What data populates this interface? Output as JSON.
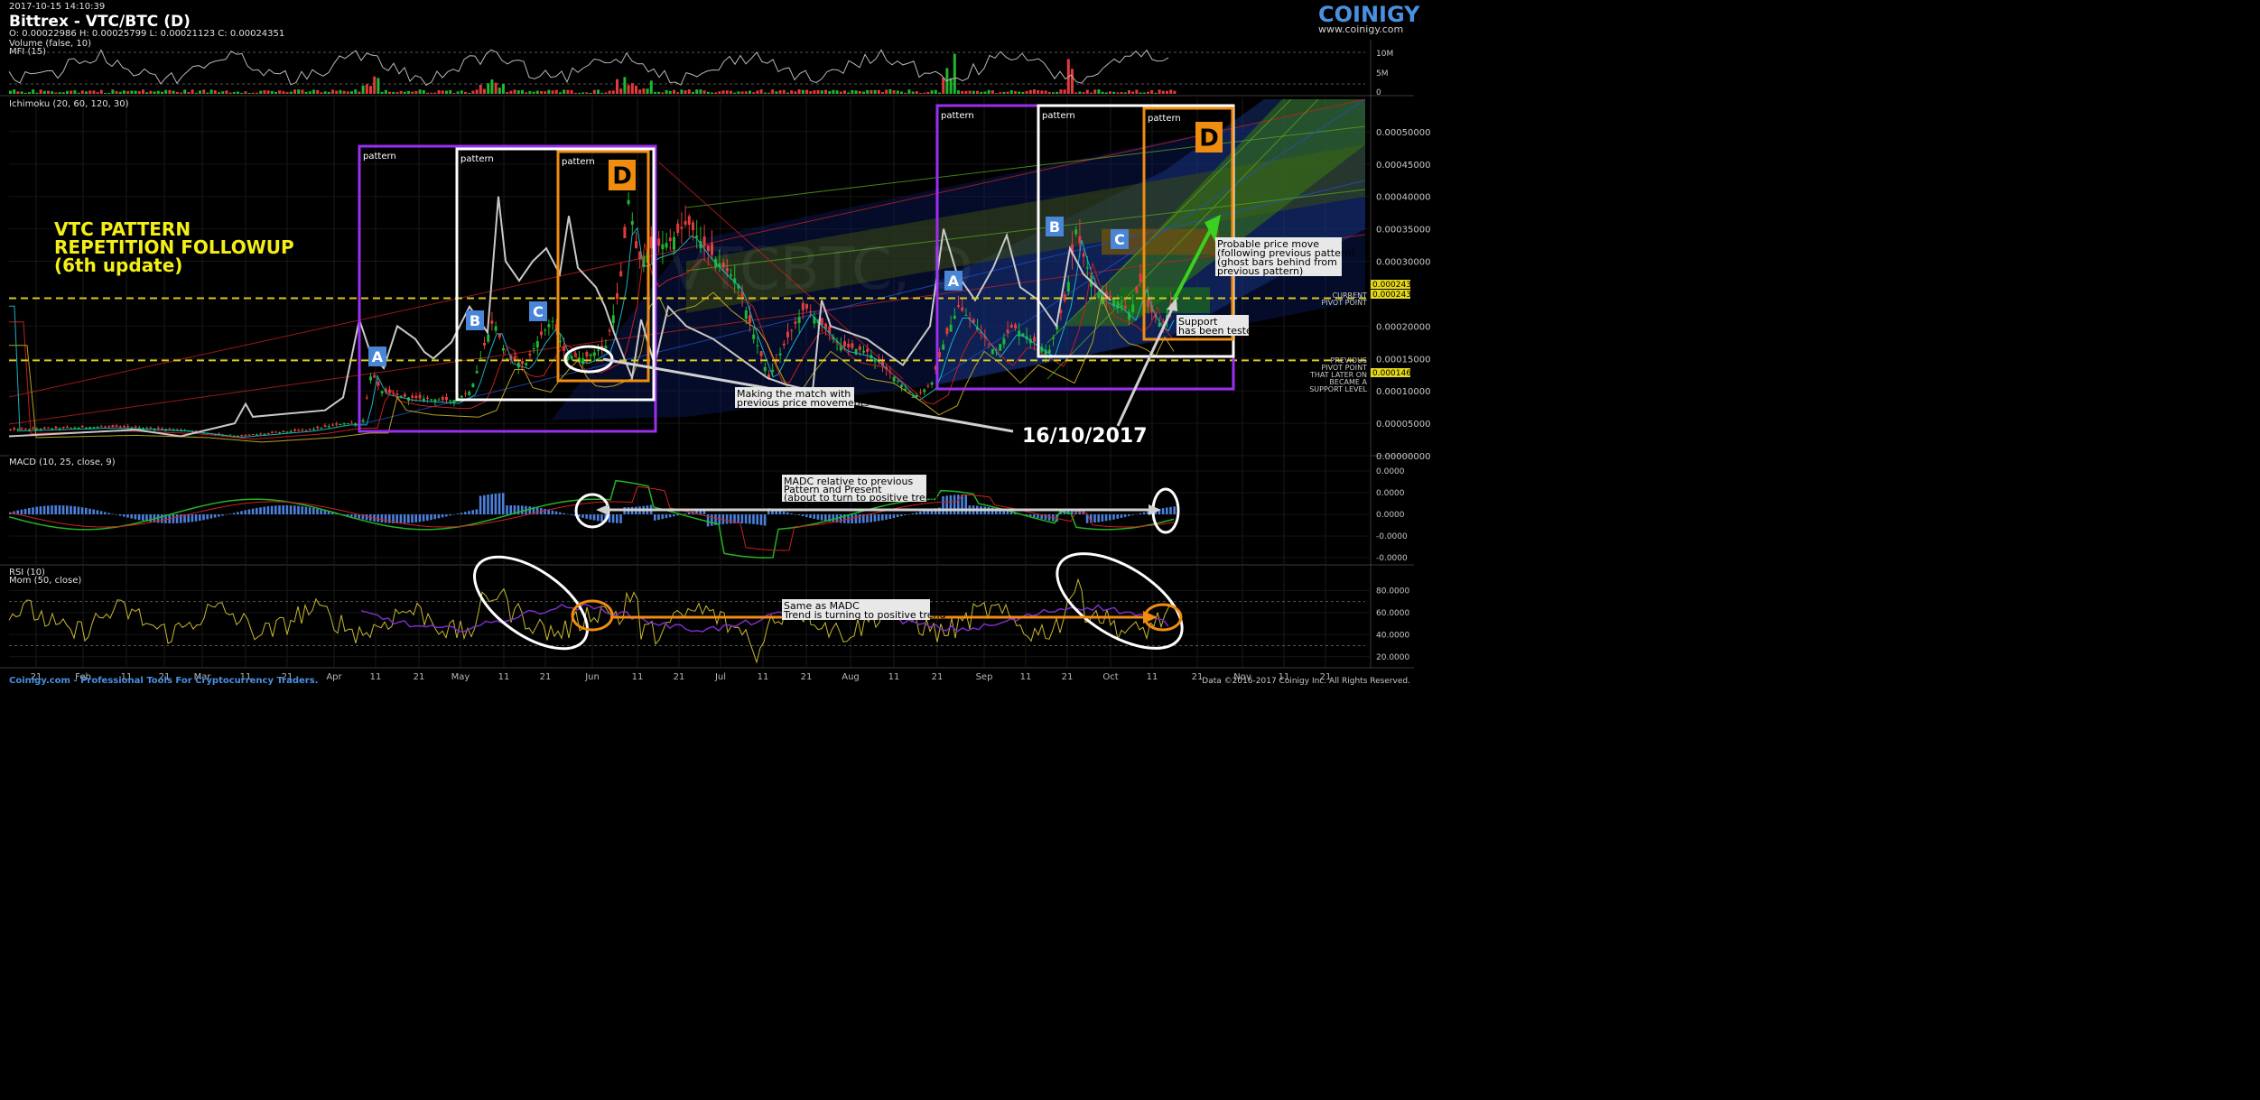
{
  "header": {
    "timestamp": "2017-10-15 14:10:39",
    "title": "Bittrex - VTC/BTC (D)",
    "ohlc": "O: 0.00022986 H: 0.00025799 L: 0.00021123 C: 0.00024351",
    "logo": "COINIGY",
    "logo_url": "www.coinigy.com"
  },
  "footer": {
    "left": "Coinigy.com - Professional Tools For Cryptocurrency Traders.",
    "right": "Data ©2016-2017 Coinigy Inc. All Rights Reserved."
  },
  "colors": {
    "background": "#000000",
    "up": "#1fb82f",
    "down": "#e33b3b",
    "mfi": "#b8b8b8",
    "macd": "#22b522",
    "signal": "#d02020",
    "histogram": "#4a7fdc",
    "rsi": "#c8b830",
    "mom": "#7a2fc8",
    "pattern_purple": "#9a2ff0",
    "pattern_orange": "#f08c10",
    "pattern_white": "#ffffff",
    "title_yellow": "#f4ef18",
    "dashed_yellow": "#d8c820",
    "label_blue": "#4a86d8"
  },
  "chart_data": [
    {
      "name": "volume-mfi",
      "type": "bar",
      "legend": [
        "Volume (false, 10)",
        "MFI (15)"
      ],
      "y_ticks": [
        "10M",
        "5M",
        "0"
      ]
    },
    {
      "name": "price",
      "type": "candlestick",
      "legend": "Ichimoku (20, 60, 120, 30)",
      "y_ticks": [
        "0.00050000",
        "0.00045000",
        "0.00040000",
        "0.00035000",
        "0.00030000",
        "0.00020000",
        "0.00015000",
        "0.00010000",
        "0.00005000",
        "0.00000000"
      ],
      "ylim": [
        0,
        0.00055
      ],
      "current_price": "0.00024351",
      "near_price": "0.00024366",
      "previous_pivot": "0.00014695",
      "current_pivot_label": [
        "CURRENT",
        "PIVOT POINT"
      ],
      "previous_pivot_label": [
        "PREVIOUS",
        "PIVOT POINT",
        "THAT LATER ON",
        "BECAME A",
        "SUPPORT LEVEL"
      ],
      "x_ticks": [
        "21",
        "Feb",
        "11",
        "21",
        "Mar",
        "11",
        "21",
        "Apr",
        "11",
        "21",
        "May",
        "11",
        "21",
        "Jun",
        "11",
        "21",
        "Jul",
        "11",
        "21",
        "Aug",
        "11",
        "21",
        "Sep",
        "11",
        "21",
        "Oct",
        "11",
        "21",
        "Nov",
        "11",
        "21"
      ],
      "annotations": {
        "headline": [
          "VTC PATTERN",
          "REPETITION FOLLOWUP",
          "(6th update)"
        ],
        "pattern": "pattern",
        "letters": [
          "A",
          "B",
          "C",
          "D"
        ],
        "match_note": [
          "Making the match with",
          "previous price movements"
        ],
        "date": "16/10/2017",
        "probable_move": [
          "Probable price move",
          "(following previous pattern)",
          "(ghost bars behind from",
          "previous pattern)"
        ],
        "support": [
          "Support",
          "has been tested"
        ],
        "watermark": "VTCBTC, D"
      }
    },
    {
      "name": "macd",
      "type": "line",
      "legend": "MACD (10, 25, close, 9)",
      "y_ticks": [
        "0.0000",
        "0.0000",
        "0.0000",
        "-0.0000",
        "-0.0000"
      ],
      "note": [
        "MADC relative to previous",
        "Pattern and Present",
        "(about to turn to positive trend)"
      ]
    },
    {
      "name": "rsi",
      "type": "line",
      "legend": [
        "RSI (10)",
        "Mom (50, close)"
      ],
      "y_ticks": [
        "80.0000",
        "60.0000",
        "40.0000",
        "20.0000"
      ],
      "ylim": [
        10,
        95
      ],
      "note": [
        "Same as MADC",
        "Trend is turning to positive trend"
      ]
    }
  ]
}
